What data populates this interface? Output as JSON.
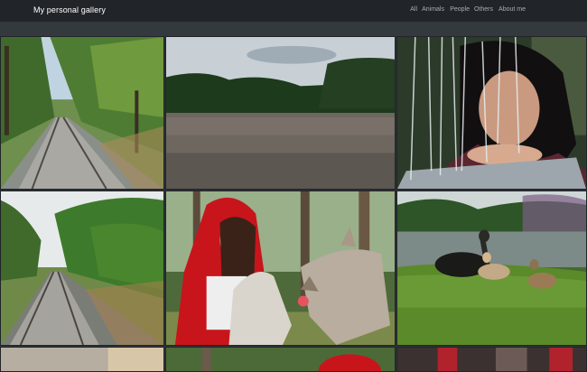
{
  "navbar": {
    "brand": "My personal gallery",
    "links": [
      "All",
      "Animals",
      "People",
      "Others",
      "About me"
    ]
  },
  "gallery": {
    "photos": [
      {
        "subject": "railway tracks through a forest"
      },
      {
        "subject": "river with tree line"
      },
      {
        "subject": "woman behind water streams"
      },
      {
        "subject": "railway tracks with motion blur"
      },
      {
        "subject": "girl in red hood with wolfdog"
      },
      {
        "subject": "ducks on the grass by a pond"
      },
      {
        "subject": "partial photo"
      },
      {
        "subject": "partial photo"
      },
      {
        "subject": "partial photo"
      }
    ]
  },
  "colors": {
    "navbar": "#212529",
    "background": "#2f3336",
    "brand_text": "#ffffff",
    "nav_link": "#a8adb2"
  }
}
